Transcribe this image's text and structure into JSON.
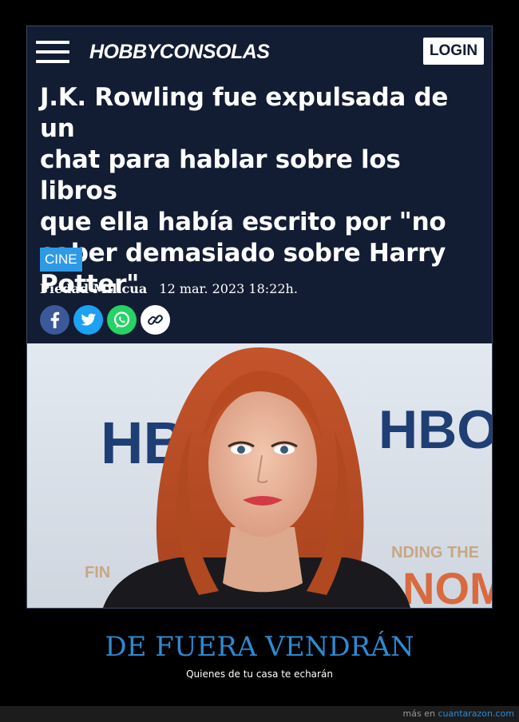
{
  "header": {
    "brand": "HOBBYCONSOLAS",
    "login_label": "LOGIN",
    "menu_icon": "hamburger-menu-icon"
  },
  "article": {
    "headline_lines": [
      "J.K. Rowling fue expulsada de un",
      "chat para hablar sobre los libros",
      "que ella había escrito por \"no",
      "saber demasiado sobre Harry",
      "Potter\""
    ],
    "category": "CINE",
    "author": "Piedad Milicua",
    "date": "12 mar. 2023 18:22h.",
    "share_buttons": [
      {
        "icon": "facebook-icon",
        "color": "#3b5998"
      },
      {
        "icon": "twitter-icon",
        "color": "#1da1f2"
      },
      {
        "icon": "whatsapp-icon",
        "color": "#25d366"
      },
      {
        "icon": "link-icon",
        "color": "#ffffff"
      }
    ],
    "photo": {
      "backdrop_text_left": "HB",
      "backdrop_text_right": "HBO",
      "backdrop_text_bottom_left": "FIN",
      "backdrop_text_bottom_right": "NDING THE",
      "backdrop_text_bottom_right_big": "NOM"
    }
  },
  "caption": {
    "title": "DE FUERA VENDRÁN",
    "subtitle": "Quienes de tu casa te echarán"
  },
  "footer": {
    "prefix": "más en",
    "link": "cuantarazon.com"
  },
  "colors": {
    "article_bg": "#121c33",
    "tag_bg": "#2e9ae6",
    "caption_title": "#2d8ad2"
  }
}
